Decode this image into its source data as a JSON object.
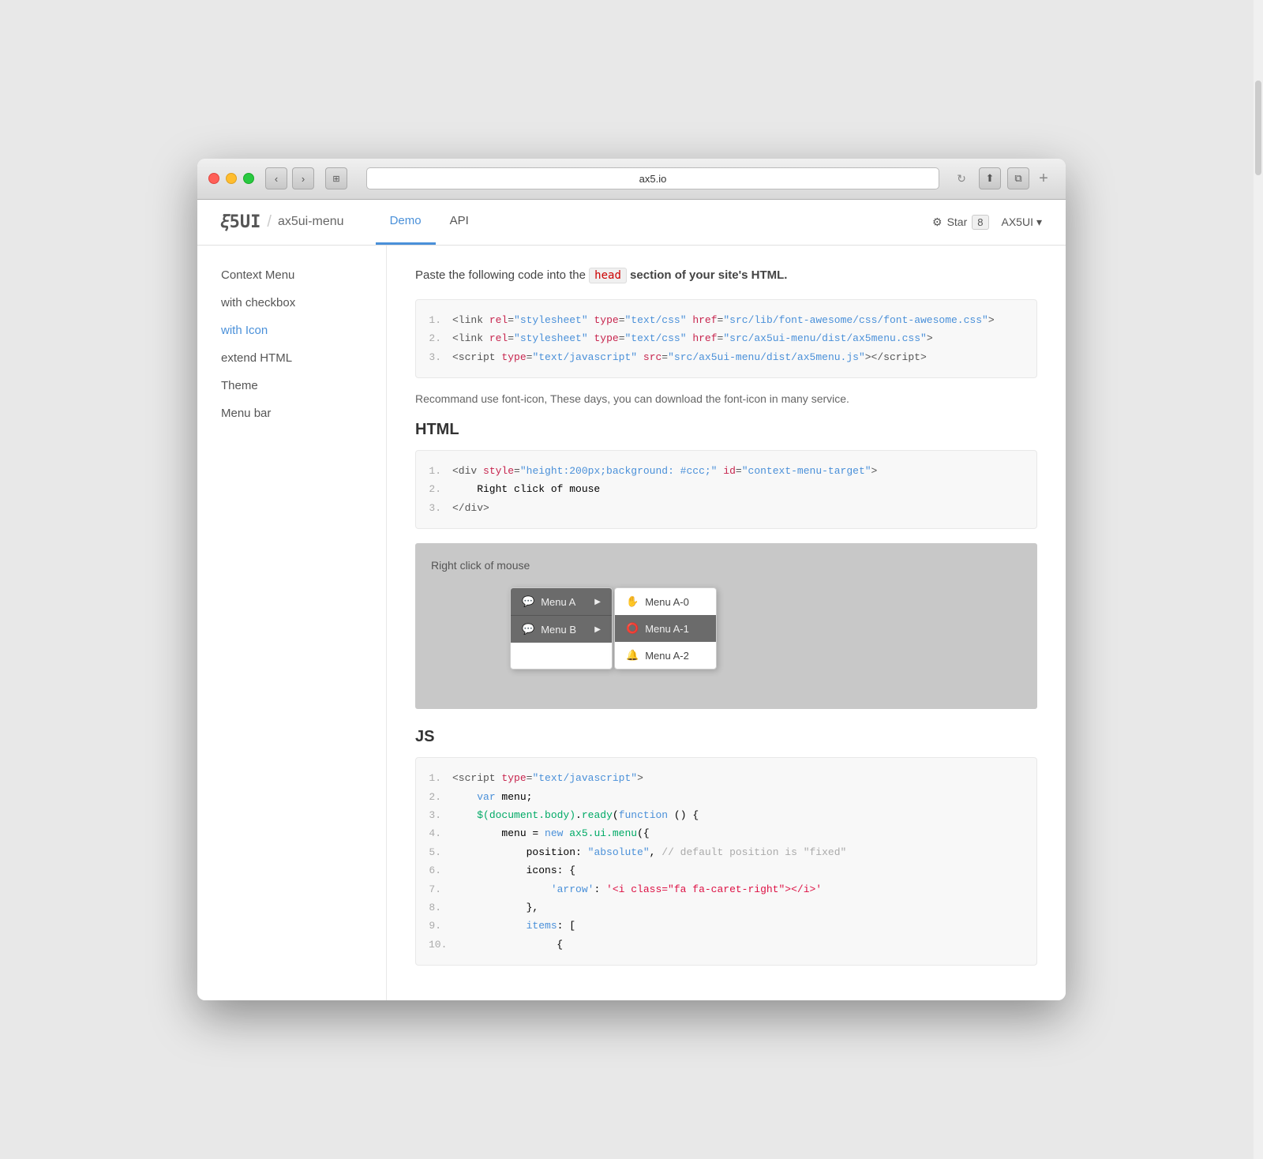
{
  "browser": {
    "url": "ax5.io",
    "traffic_lights": [
      "red",
      "yellow",
      "green"
    ]
  },
  "header": {
    "logo": "X5UI",
    "separator": "/",
    "project": "ax5ui-menu",
    "nav_tabs": [
      {
        "label": "Demo",
        "active": true
      },
      {
        "label": "API",
        "active": false
      }
    ],
    "star_label": "Star",
    "star_count": "8",
    "ax5ui_label": "AX5UI"
  },
  "sidebar": {
    "items": [
      {
        "label": "Context Menu",
        "active": false
      },
      {
        "label": "with checkbox",
        "active": false
      },
      {
        "label": "with Icon",
        "active": true
      },
      {
        "label": "extend HTML",
        "active": false
      },
      {
        "label": "Theme",
        "active": false
      },
      {
        "label": "Menu bar",
        "active": false
      }
    ]
  },
  "main": {
    "intro_text": "Paste the following code into the",
    "highlight": "head",
    "intro_end": "section of your site's HTML.",
    "code_head": [
      {
        "num": "1.",
        "content": "<link rel=\"stylesheet\" type=\"text/css\" href=\"src/lib/font-awesome/css/font-awesome.css\">"
      },
      {
        "num": "2.",
        "content": "<link rel=\"stylesheet\" type=\"text/css\" href=\"src/ax5ui-menu/dist/ax5menu.css\">"
      },
      {
        "num": "3.",
        "content": "<script type=\"text/javascript\" src=\"src/ax5ui-menu/dist/ax5menu.js\"></script>"
      }
    ],
    "recommend_text": "Recommand use font-icon, These days, you can download the font-icon in many service.",
    "html_section_title": "HTML",
    "code_html": [
      {
        "num": "1.",
        "content": "<div style=\"height:200px;background: #ccc;\" id=\"context-menu-target\">"
      },
      {
        "num": "2.",
        "content": "    Right click of mouse"
      },
      {
        "num": "3.",
        "content": "</div>"
      }
    ],
    "demo_label": "Right click of mouse",
    "menu": {
      "items": [
        {
          "label": "Menu A",
          "icon": "💬",
          "has_sub": true
        },
        {
          "label": "Menu B",
          "icon": "💬",
          "has_sub": true
        }
      ],
      "sub_items": [
        {
          "label": "Menu A-0",
          "icon": "✋"
        },
        {
          "label": "Menu A-1",
          "icon": "⭕"
        },
        {
          "label": "Menu A-2",
          "icon": "🔔"
        }
      ]
    },
    "js_section_title": "JS",
    "code_js": [
      {
        "num": "1.",
        "content": "<script type=\"text/javascript\">"
      },
      {
        "num": "2.",
        "content": "    var menu;"
      },
      {
        "num": "3.",
        "content": "    $(document.body).ready(function () {"
      },
      {
        "num": "4.",
        "content": "        menu = new ax5.ui.menu({"
      },
      {
        "num": "5.",
        "content": "            position: \"absolute\", // default position is \"fixed\""
      },
      {
        "num": "6.",
        "content": "            icons: {"
      },
      {
        "num": "7.",
        "content": "                'arrow': '<i class=\"fa fa-caret-right\"><\\/i>'"
      },
      {
        "num": "8.",
        "content": "            },"
      },
      {
        "num": "9.",
        "content": "            items: ["
      },
      {
        "num": "10.",
        "content": "                {"
      }
    ],
    "ready_text": "ready",
    "items_text": "items"
  }
}
